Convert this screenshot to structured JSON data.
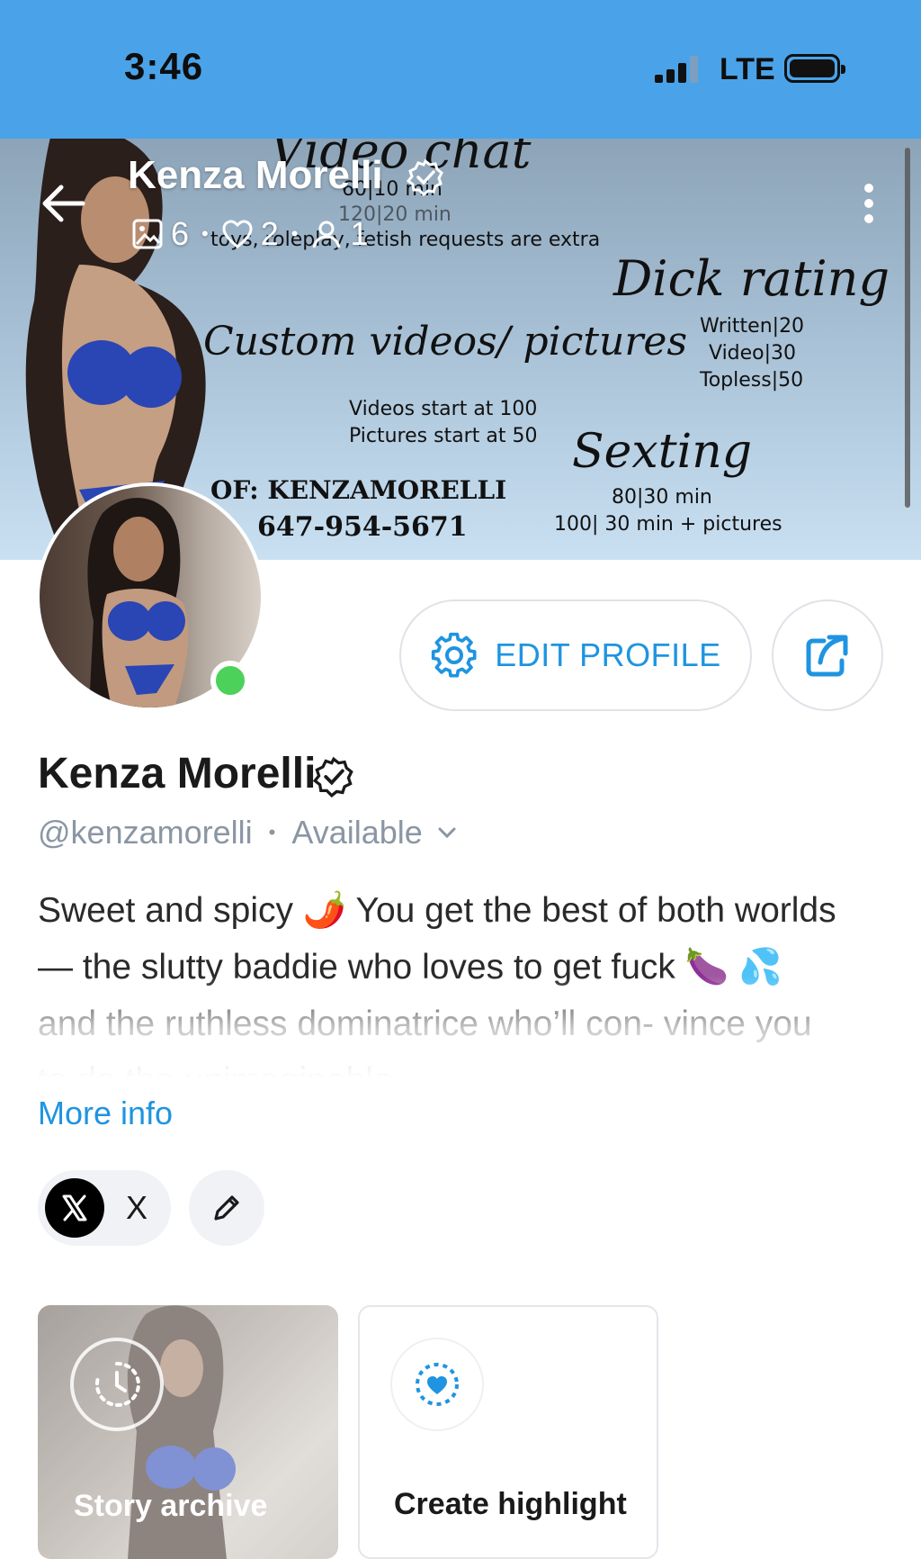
{
  "status_bar": {
    "time": "3:46",
    "network": "LTE"
  },
  "header": {
    "name": "Kenza Morelli",
    "stats": {
      "media": "6",
      "likes": "2",
      "fans": "1"
    }
  },
  "cover": {
    "video_chat": {
      "title": "Video chat",
      "lines": [
        "60|10 min",
        "120|20 min"
      ]
    },
    "extras": "toys, roleplay, fetish requests are extra",
    "dick_rating": {
      "title": "Dick rating",
      "lines": [
        "Written|20",
        "Video|30",
        "Topless|50"
      ]
    },
    "custom": {
      "title": "Custom videos/ pictures",
      "lines": [
        "Videos start at 100",
        "Pictures start at 50"
      ]
    },
    "sexting": {
      "title": "Sexting",
      "lines": [
        "80|30 min",
        "100| 30 min + pictures"
      ]
    },
    "of_line": "OF: KENZAMORELLI",
    "phone": "647-954-5671"
  },
  "actions": {
    "edit_profile": "EDIT PROFILE"
  },
  "profile": {
    "name": "Kenza Morelli",
    "handle": "@kenzamorelli",
    "availability": "Available",
    "bio": "Sweet and spicy 🌶️ You get the best of both worlds— the slutty baddie who loves to get fuck 🍆 💦 and the ruthless dominatrice who’ll con- vince you to do the unimaginable.",
    "more_info": "More info"
  },
  "socials": [
    {
      "label": "X"
    }
  ],
  "highlights": [
    {
      "label": "Story archive"
    },
    {
      "label": "Create highlight"
    }
  ],
  "colors": {
    "accent": "#1f94e0",
    "status_bar": "#4aa3e8",
    "online": "#4cd15a",
    "muted": "#8a96a3"
  }
}
